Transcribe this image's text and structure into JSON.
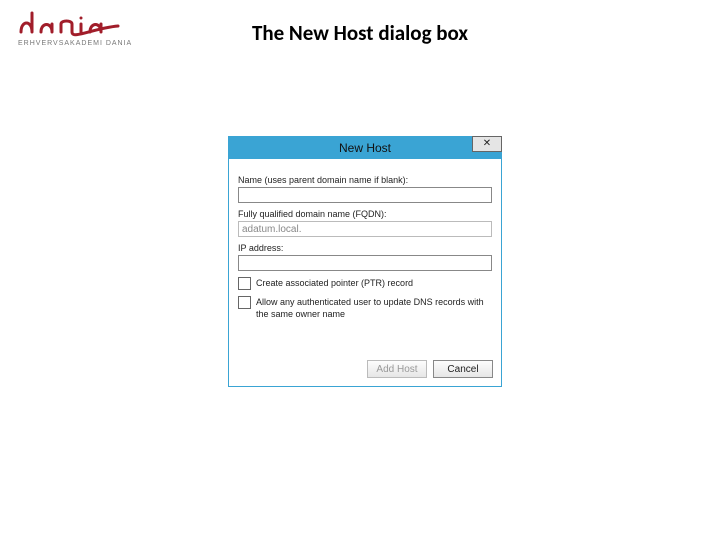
{
  "logo": {
    "subtext": "ERHVERVSAKADEMI DANIA"
  },
  "title": "The New Host dialog box",
  "dialog": {
    "window_title": "New Host",
    "close_glyph": "✕",
    "fields": {
      "name_label": "Name (uses parent domain name if blank):",
      "name_value": "",
      "fqdn_label": "Fully qualified domain name (FQDN):",
      "fqdn_value": "adatum.local.",
      "ip_label": "IP address:",
      "ip_value": ""
    },
    "checks": {
      "ptr_label": "Create associated pointer (PTR) record",
      "secure_label": "Allow any authenticated user to update DNS records with the same owner name"
    },
    "buttons": {
      "add_host": "Add Host",
      "cancel": "Cancel"
    }
  }
}
